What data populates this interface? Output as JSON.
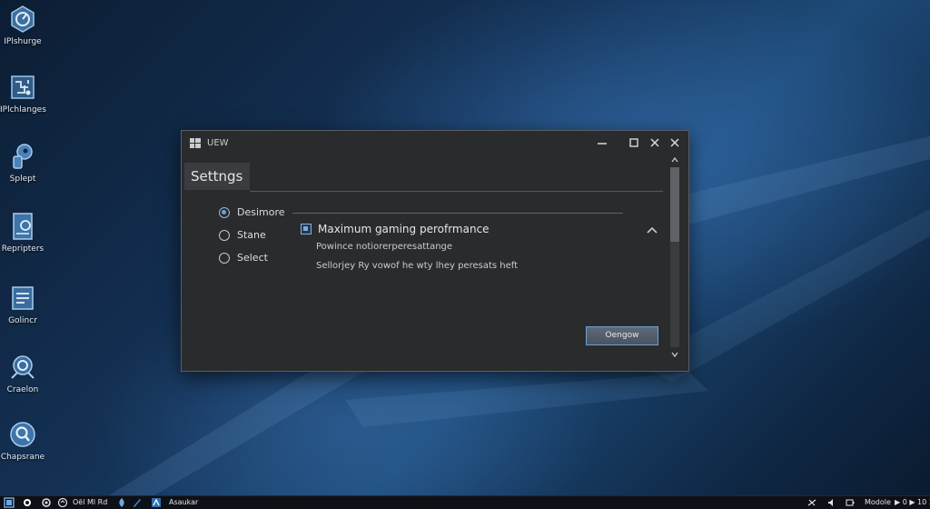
{
  "desktop": {
    "icons": [
      {
        "label": "IPlshurge",
        "icon": "gauge-icon"
      },
      {
        "label": "IPlchlanges",
        "icon": "circuit-icon"
      },
      {
        "label": "Splept",
        "icon": "key-icon"
      },
      {
        "label": "Repripters",
        "icon": "document-icon"
      },
      {
        "label": "Golincr",
        "icon": "notes-icon"
      },
      {
        "label": "Craelon",
        "icon": "search-icon"
      },
      {
        "label": "Chapsrane",
        "icon": "magnifier-icon"
      }
    ]
  },
  "window": {
    "title": "UEW",
    "section_header": "Settngs",
    "radio_options": [
      {
        "label": "Desimore",
        "selected": true
      },
      {
        "label": "Stane",
        "selected": false
      },
      {
        "label": "Select",
        "selected": false
      }
    ],
    "checkbox_label": "Maximum gaming perofrmance",
    "checkbox_checked": true,
    "description_line1": "Powince notiorerperesattange",
    "description_line2": "Sellorjey Ry vowof he wty lhey peresats heft",
    "action_button": "Oengow"
  },
  "taskbar": {
    "left_text": "Oël Ml Rd",
    "app_label": "Asaukar",
    "right_text": "Modole",
    "clock": "▶ 0 ▶ 10 1"
  },
  "colors": {
    "accent": "#6d9fd6",
    "window_bg": "#2a2b2d",
    "taskbar_bg": "#0d1117"
  }
}
